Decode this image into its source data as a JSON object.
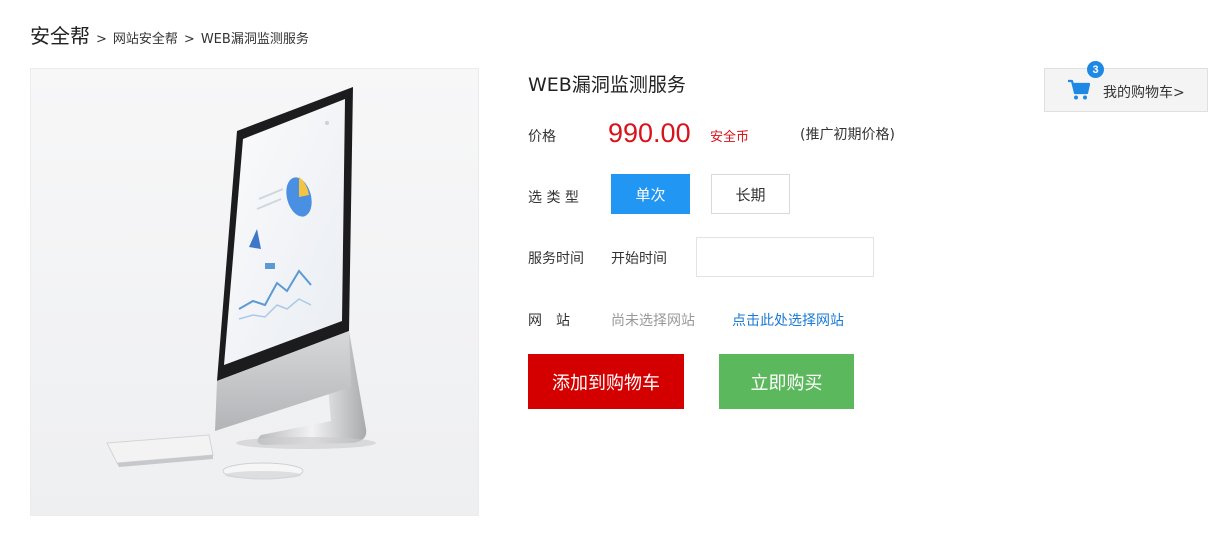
{
  "breadcrumb": {
    "home": "安全帮",
    "separator": ">",
    "level1": "网站安全帮",
    "level2": "WEB漏洞监测服务"
  },
  "product": {
    "title": "WEB漏洞监测服务",
    "image_icon": "imac-product-photo"
  },
  "price": {
    "label": "价格",
    "value": "990.00",
    "unit": "安全币",
    "note": "(推广初期价格)"
  },
  "type_select": {
    "label": "选 类 型",
    "options": [
      "单次",
      "长期"
    ],
    "selected": "单次"
  },
  "service_time": {
    "label": "服务时间",
    "start_label": "开始时间",
    "start_value": ""
  },
  "website": {
    "label": "网　站",
    "status": "尚未选择网站",
    "select_link": "点击此处选择网站"
  },
  "actions": {
    "add_to_cart": "添加到购物车",
    "buy_now": "立即购买"
  },
  "cart": {
    "count": "3",
    "label": "我的购物车>",
    "icon": "shopping-cart-icon"
  },
  "colors": {
    "price_red": "#d9121b",
    "active_blue": "#2196f3",
    "cart_button_red": "#d40000",
    "buy_button_green": "#5cb85c",
    "link_blue": "#1a7ad6",
    "badge_blue": "#1e88e5"
  }
}
